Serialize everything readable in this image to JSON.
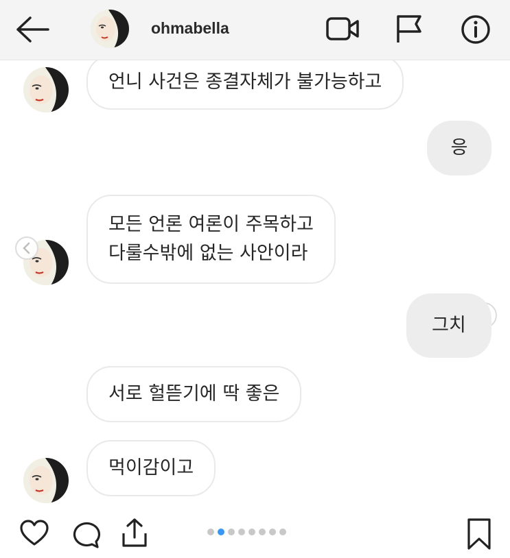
{
  "header": {
    "back_icon": "arrow-left-icon",
    "username": "ohmabella",
    "video_icon": "video-camera-icon",
    "flag_icon": "flag-icon",
    "info_icon": "info-icon"
  },
  "messages": [
    {
      "side": "received",
      "text": "언니 사건은 종결자체가 불가능하고"
    },
    {
      "side": "sent",
      "text": "응"
    },
    {
      "side": "received",
      "text": "모든 언론 여론이 주목하고\n다룰수밖에 없는 사안이라"
    },
    {
      "side": "sent",
      "text": "그치"
    },
    {
      "side": "received",
      "text": "서로 헐뜯기에 딱 좋은"
    },
    {
      "side": "received",
      "text": "먹이감이고"
    }
  ],
  "carousel": {
    "total": 8,
    "active_index": 1
  },
  "footer": {
    "like_icon": "heart-icon",
    "comment_icon": "comment-icon",
    "share_icon": "share-icon",
    "save_icon": "bookmark-icon"
  },
  "colors": {
    "header_bg": "#f4f4f4",
    "sent_bubble": "#ededed",
    "received_border": "#e9e9e9",
    "active_dot": "#3897f0"
  }
}
